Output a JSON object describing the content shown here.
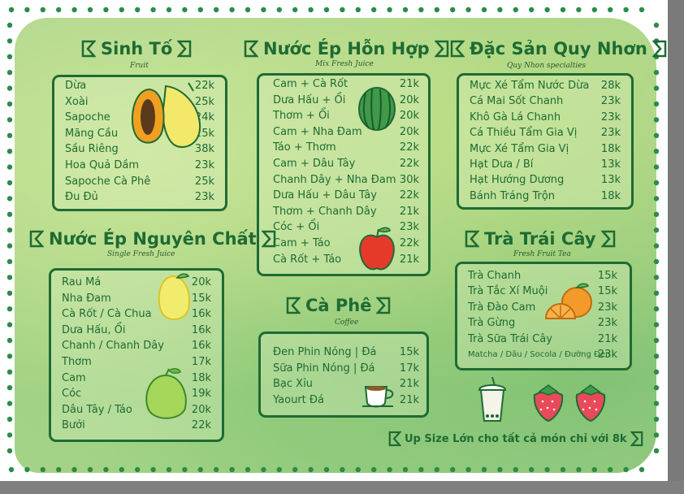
{
  "sections": {
    "sinh_to": {
      "title": "Sinh Tố",
      "subtitle": "Fruit",
      "items": [
        {
          "name": "Dừa",
          "price": "22k"
        },
        {
          "name": "Xoài",
          "price": "25k"
        },
        {
          "name": "Sapoche",
          "price": "24k"
        },
        {
          "name": "Mãng Cầu",
          "price": "25k"
        },
        {
          "name": "Sầu Riêng",
          "price": "38k"
        },
        {
          "name": "Hoa Quả Dầm",
          "price": "23k"
        },
        {
          "name": "Sapoche Cà Phê",
          "price": "25k"
        },
        {
          "name": "Đu Đủ",
          "price": "23k"
        }
      ]
    },
    "nuoc_ep_hon_hop": {
      "title": "Nước Ép Hỗn Hợp",
      "subtitle": "Mix Fresh Juice",
      "items": [
        {
          "name": "Cam + Cà Rốt",
          "price": "21k"
        },
        {
          "name": "Dưa Hấu + Ổi",
          "price": "20k"
        },
        {
          "name": "Thơm + Ổi",
          "price": "20k"
        },
        {
          "name": "Cam + Nha Đam",
          "price": "20k"
        },
        {
          "name": "Táo + Thơm",
          "price": "22k"
        },
        {
          "name": "Cam + Dâu Tây",
          "price": "22k"
        },
        {
          "name": "Chanh Dây + Nha Đam",
          "price": "30k"
        },
        {
          "name": "Dưa Hấu + Dâu Tây",
          "price": "22k"
        },
        {
          "name": "Thơm + Chanh Dây",
          "price": "21k"
        },
        {
          "name": "Cóc + Ổi",
          "price": "23k"
        },
        {
          "name": "Cam + Táo",
          "price": "22k"
        },
        {
          "name": "Cà Rốt + Táo",
          "price": "21k"
        }
      ]
    },
    "dac_san": {
      "title": "Đặc Sản Quy Nhơn",
      "subtitle": "Quy Nhon specialties",
      "items": [
        {
          "name": "Mực Xé Tẩm Nước Dừa",
          "price": "28k"
        },
        {
          "name": "Cá Mai Sốt Chanh",
          "price": "23k"
        },
        {
          "name": "Khô Gà Lá Chanh",
          "price": "23k"
        },
        {
          "name": "Cá Thiều Tẩm Gia Vị",
          "price": "23k"
        },
        {
          "name": "Mực Xé Tẩm Gia Vị",
          "price": "18k"
        },
        {
          "name": "Hạt Dưa / Bí",
          "price": "13k"
        },
        {
          "name": "Hạt Hướng Dương",
          "price": "13k"
        },
        {
          "name": "Bánh Tráng Trộn",
          "price": "18k"
        }
      ]
    },
    "nuoc_ep_nguyen_chat": {
      "title": "Nước Ép Nguyên Chất",
      "subtitle": "Single Fresh Juice",
      "items": [
        {
          "name": "Rau Má",
          "price": "20k"
        },
        {
          "name": "Nha Đam",
          "price": "15k"
        },
        {
          "name": "Cà Rốt / Cà Chua",
          "price": "16k"
        },
        {
          "name": "Dưa Hấu, Ổi",
          "price": "16k"
        },
        {
          "name": "Chanh / Chanh Dây",
          "price": "16k"
        },
        {
          "name": "Thơm",
          "price": "17k"
        },
        {
          "name": "Cam",
          "price": "18k"
        },
        {
          "name": "Cóc",
          "price": "19k"
        },
        {
          "name": "Dâu Tây / Táo",
          "price": "20k"
        },
        {
          "name": "Bưởi",
          "price": "22k"
        }
      ]
    },
    "ca_phe": {
      "title": "Cà Phê",
      "subtitle": "Coffee",
      "items": [
        {
          "name": "Đen Phin Nóng | Đá",
          "price": "15k"
        },
        {
          "name": "Sữa Phin Nóng | Đá",
          "price": "17k"
        },
        {
          "name": "Bạc Xỉu",
          "price": "21k"
        },
        {
          "name": "Yaourt Đá",
          "price": "21k"
        }
      ]
    },
    "tra_trai_cay": {
      "title": "Trà Trái Cây",
      "subtitle": "Fresh Fruit Tea",
      "items": [
        {
          "name": "Trà Chanh",
          "price": "15k"
        },
        {
          "name": "Trà Tắc Xí Muội",
          "price": "15k"
        },
        {
          "name": "Trà Đào Cam",
          "price": "23k"
        },
        {
          "name": "Trà Gừng",
          "price": "23k"
        },
        {
          "name": "Trà Sữa Trái Cây",
          "price": "21k"
        },
        {
          "name": "Matcha / Dâu / Socola / Đường Đen",
          "price": "23k"
        }
      ]
    }
  },
  "note": "Up Size Lớn cho tất cả món chỉ với 8k",
  "colors": {
    "primary": "#1e6b34",
    "wash": "#a9d48e",
    "dots": "#2e8b4a"
  },
  "icons": [
    "papaya-icon",
    "watermelon-icon",
    "apple-icon",
    "lemon-icon",
    "guava-icon",
    "coffee-cup-icon",
    "orange-icon",
    "bubble-tea-icon",
    "strawberry-icon"
  ]
}
